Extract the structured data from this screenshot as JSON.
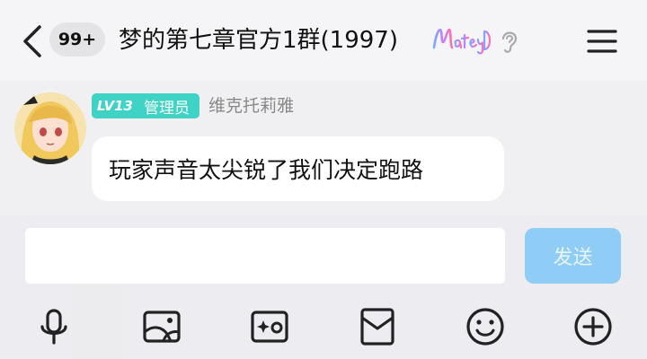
{
  "header": {
    "back_icon": "chevron-left-icon",
    "unread_badge": "99+",
    "title": "梦的第七章官方1群(1997)",
    "brand_logo_text": "Matey",
    "ear_icon": "ear-icon",
    "menu_icon": "hamburger-menu-icon"
  },
  "message": {
    "level": "LV13",
    "role": "管理员",
    "sender": "维克托莉雅",
    "text": "玩家声音太尖锐了我们决定跑路"
  },
  "composer": {
    "input_value": "",
    "send_label": "发送"
  },
  "toolbar": {
    "items": [
      "microphone-icon",
      "image-icon",
      "sticker-image-icon",
      "red-packet-icon",
      "emoji-icon",
      "plus-icon"
    ]
  },
  "colors": {
    "badge_teal": "#3fd3c6",
    "send_disabled": "#8fcdf7"
  }
}
